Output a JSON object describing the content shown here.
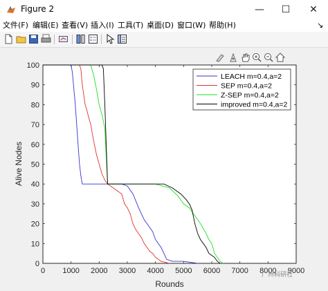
{
  "window": {
    "title": "Figure 2",
    "minimize_label": "—",
    "maximize_label": "☐",
    "close_label": "✕"
  },
  "menu": {
    "items": [
      {
        "label": "文件(F)"
      },
      {
        "label": "编辑(E)"
      },
      {
        "label": "查看(V)"
      },
      {
        "label": "插入(I)"
      },
      {
        "label": "工具(T)"
      },
      {
        "label": "桌面(D)"
      },
      {
        "label": "窗口(W)"
      },
      {
        "label": "帮助(H)"
      }
    ],
    "overflow_label": "↘"
  },
  "toolbar": {
    "buttons": [
      "new-figure-icon",
      "open-folder-icon",
      "save-icon",
      "print-icon",
      "link-icon",
      "colorbar-icon",
      "legend-icon",
      "pointer-icon",
      "property-inspector-icon"
    ]
  },
  "axes_toolbar": {
    "buttons": [
      "brush-icon",
      "data-tips-icon",
      "pan-icon",
      "zoom-in-icon",
      "zoom-out-icon",
      "home-icon"
    ]
  },
  "watermark": "广州科研社",
  "chart_data": {
    "type": "line",
    "xlabel": "Rounds",
    "ylabel": "Alive Nodes",
    "xlim": [
      0,
      9000
    ],
    "ylim": [
      0,
      100
    ],
    "xticks": [
      0,
      1000,
      2000,
      3000,
      4000,
      5000,
      6000,
      7000,
      8000,
      9000
    ],
    "yticks": [
      0,
      10,
      20,
      30,
      40,
      50,
      60,
      70,
      80,
      90,
      100
    ],
    "grid": false,
    "legend_position": "top-right",
    "series": [
      {
        "name": "LEACH  m=0.4,a=2",
        "color": "#3333cc",
        "x": [
          0,
          1000,
          1050,
          1100,
          1150,
          1200,
          1250,
          1300,
          1350,
          1400,
          1500,
          1600,
          1800,
          2000,
          2200,
          2500,
          2800,
          3000,
          3200,
          3400,
          3500,
          3600,
          3700,
          3800,
          3900,
          4000,
          4100,
          4200,
          4300,
          4400,
          4600,
          5000,
          5500
        ],
        "y": [
          100,
          100,
          96,
          88,
          80,
          70,
          60,
          50,
          44,
          40,
          40,
          40,
          40,
          40,
          40,
          40,
          40,
          39,
          35,
          28,
          25,
          22,
          20,
          18,
          16,
          12,
          10,
          8,
          5,
          2,
          1,
          1,
          0
        ]
      },
      {
        "name": "SEP  m=0.4,a=2",
        "color": "#e03030",
        "x": [
          0,
          1300,
          1350,
          1400,
          1450,
          1500,
          1550,
          1600,
          1700,
          1800,
          1900,
          2000,
          2100,
          2200,
          2300,
          2500,
          2700,
          2800,
          2900,
          3000,
          3100,
          3200,
          3300,
          3400,
          3500,
          3600,
          3700,
          3800,
          3900,
          4000,
          4200,
          4500
        ],
        "y": [
          100,
          100,
          98,
          90,
          85,
          80,
          78,
          75,
          70,
          62,
          55,
          50,
          45,
          42,
          40,
          38,
          36,
          35,
          30,
          28,
          25,
          20,
          17,
          15,
          13,
          10,
          8,
          6,
          5,
          3,
          1,
          0
        ]
      },
      {
        "name": "Z-SEP  m=0.4,a=2",
        "color": "#22dd22",
        "x": [
          0,
          1700,
          1800,
          1900,
          2000,
          2100,
          2200,
          2300,
          2400,
          2600,
          3000,
          3500,
          4000,
          4500,
          4800,
          5000,
          5200,
          5400,
          5600,
          5800,
          5900,
          6000,
          6100,
          6200,
          6300,
          6400
        ],
        "y": [
          100,
          100,
          95,
          88,
          80,
          75,
          68,
          40,
          40,
          40,
          40,
          40,
          40,
          38,
          34,
          30,
          28,
          24,
          20,
          15,
          12,
          10,
          5,
          3,
          1,
          0
        ]
      },
      {
        "name": "improved  m=0.4,a=2",
        "color": "#000000",
        "x": [
          0,
          2100,
          2150,
          2200,
          2250,
          2300,
          2400,
          2600,
          3000,
          3500,
          4000,
          4300,
          4600,
          4900,
          5100,
          5200,
          5300,
          5400,
          5500,
          5600,
          5700,
          5800,
          5900,
          6000,
          6100,
          6200,
          6300
        ],
        "y": [
          100,
          100,
          98,
          80,
          60,
          40,
          40,
          40,
          40,
          40,
          40,
          40,
          38,
          35,
          32,
          30,
          27,
          20,
          15,
          12,
          10,
          8,
          5,
          4,
          3,
          1,
          0
        ]
      }
    ]
  }
}
